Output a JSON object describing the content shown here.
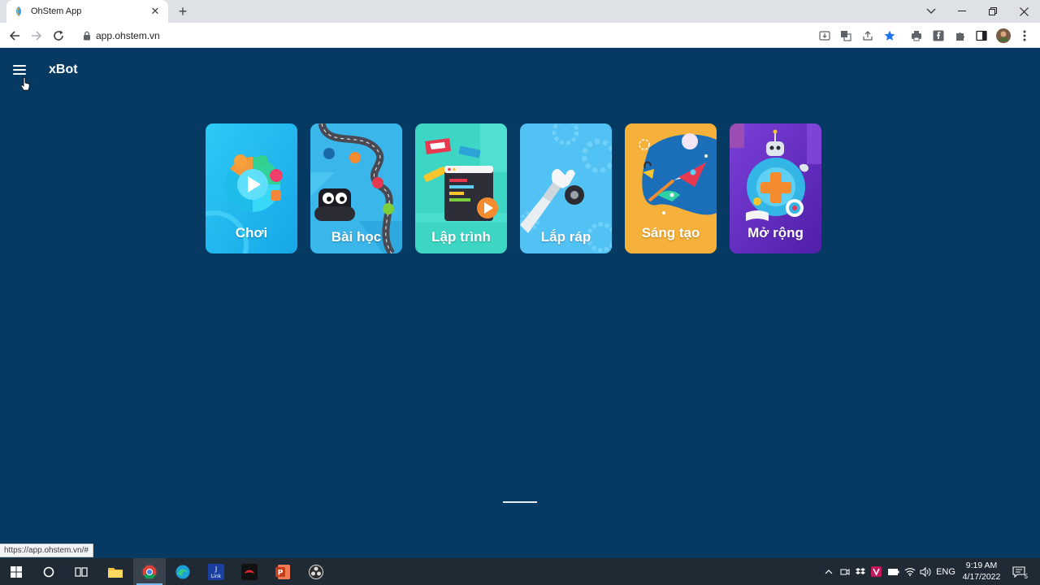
{
  "browser": {
    "tab_title": "OhStem App",
    "new_tab": "+",
    "url": "app.ohstem.vn",
    "status_url": "https://app.ohstem.vn/#"
  },
  "app": {
    "title": "xBot",
    "cards": [
      {
        "label": "Chơi",
        "icon": "play-game-icon"
      },
      {
        "label": "Bài học",
        "icon": "lesson-map-icon"
      },
      {
        "label": "Lập trình",
        "icon": "coding-icon"
      },
      {
        "label": "Lắp ráp",
        "icon": "robot-arm-icon"
      },
      {
        "label": "Sáng tạo",
        "icon": "rocket-icon"
      },
      {
        "label": "Mở rộng",
        "icon": "extension-plus-icon"
      }
    ]
  },
  "taskbar": {
    "lang": "ENG",
    "time": "9:19 AM",
    "date": "4/17/2022",
    "notifications": "5"
  }
}
